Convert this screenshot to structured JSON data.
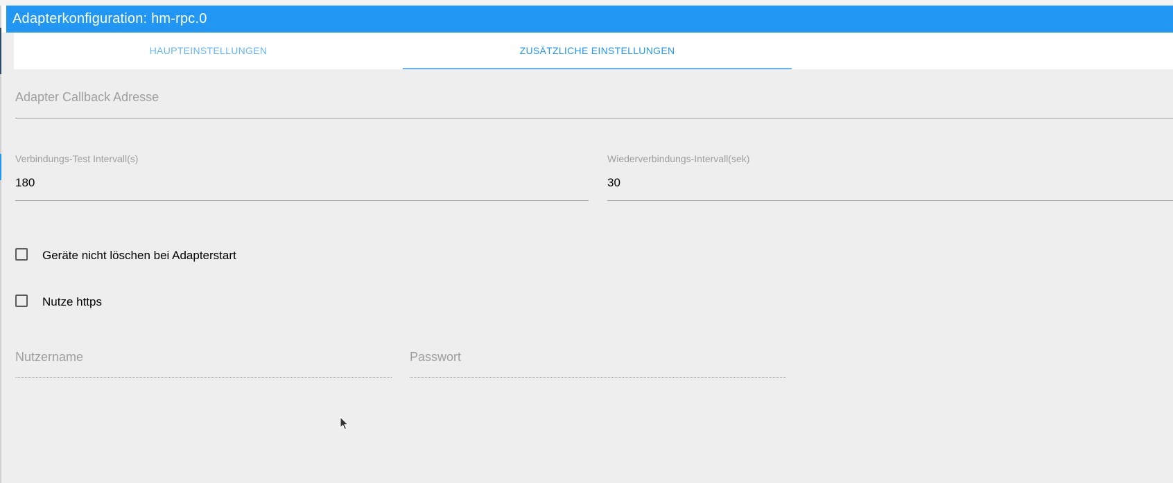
{
  "window": {
    "title": "Adapterkonfiguration: hm-rpc.0"
  },
  "tabs": [
    {
      "label": "HAUPTEINSTELLUNGEN",
      "active": false
    },
    {
      "label": "ZUSÄTZLICHE EINSTELLUNGEN",
      "active": true
    }
  ],
  "form": {
    "callback_address": {
      "label": "Adapter Callback Adresse",
      "value": ""
    },
    "connection_test_interval": {
      "label": "Verbindungs-Test Intervall(s)",
      "value": "180"
    },
    "reconnect_interval": {
      "label": "Wiederverbindungs-Intervall(sek)",
      "value": "30"
    },
    "dont_delete_devices": {
      "label": "Geräte nicht löschen bei Adapterstart",
      "checked": false
    },
    "use_https": {
      "label": "Nutze https",
      "checked": false
    },
    "username": {
      "label": "Nutzername",
      "value": ""
    },
    "password": {
      "label": "Passwort",
      "value": ""
    }
  },
  "colors": {
    "primary": "#2196f3",
    "tab_text": "#64b5f6",
    "background": "#eeeeee",
    "label_gray": "#9e9e9e"
  },
  "icons": {
    "mouse_pointer": "mouse-pointer-icon"
  }
}
